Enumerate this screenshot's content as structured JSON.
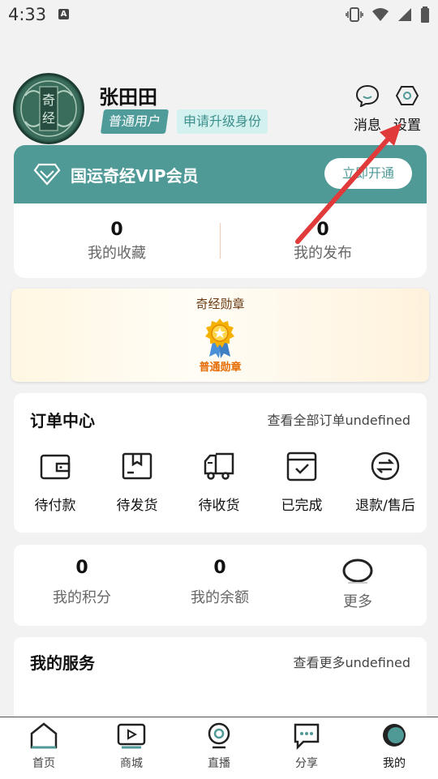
{
  "status_bar": {
    "time": "4:33",
    "notification_badge": "A"
  },
  "profile": {
    "name": "张田田",
    "level_badge": "普通用户",
    "upgrade_badge": "申请升级身份",
    "avatar_text": "奇经"
  },
  "top_actions": {
    "messages": "消息",
    "settings": "设置"
  },
  "vip": {
    "title": "国运奇经VIP会员",
    "cta": "立即开通",
    "favorites_count": "0",
    "favorites_label": "我的收藏",
    "posts_count": "0",
    "posts_label": "我的发布"
  },
  "medals": {
    "title": "奇经勋章",
    "medal_label": "普通勋章"
  },
  "orders": {
    "title": "订单中心",
    "view_all": "查看全部订单undefined",
    "items": [
      {
        "label": "待付款",
        "icon": "wallet-icon"
      },
      {
        "label": "待发货",
        "icon": "package-icon"
      },
      {
        "label": "待收货",
        "icon": "truck-icon"
      },
      {
        "label": "已完成",
        "icon": "checked-box-icon"
      },
      {
        "label": "退款/售后",
        "icon": "exchange-icon"
      }
    ]
  },
  "assets": {
    "points_count": "0",
    "points_label": "我的积分",
    "balance_count": "0",
    "balance_label": "我的余额",
    "more_label": "更多"
  },
  "services": {
    "title": "我的服务",
    "view_more": "查看更多undefined"
  },
  "tabbar": {
    "items": [
      {
        "label": "首页",
        "icon": "home-icon"
      },
      {
        "label": "商城",
        "icon": "tv-icon"
      },
      {
        "label": "直播",
        "icon": "camera-icon"
      },
      {
        "label": "分享",
        "icon": "chat-icon"
      },
      {
        "label": "我的",
        "icon": "profile-icon"
      }
    ],
    "active_index": 4
  },
  "colors": {
    "accent": "#4f9a97",
    "accent_light": "#d3f2ef",
    "arrow": "#e03a3a",
    "medal_orange": "#e66b00"
  }
}
